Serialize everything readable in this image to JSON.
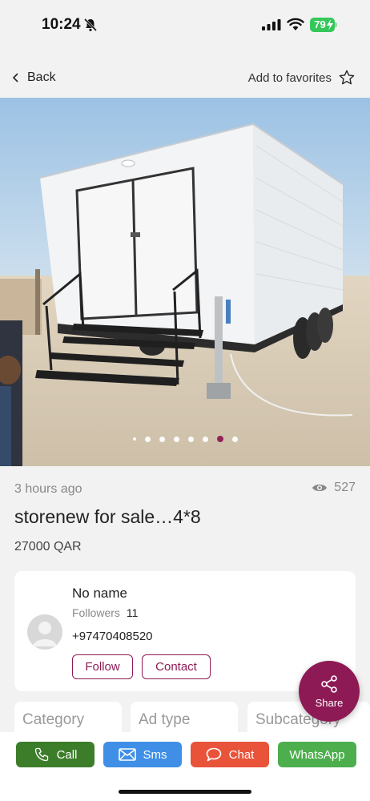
{
  "status_bar": {
    "time": "10:24",
    "battery": "79"
  },
  "nav": {
    "back_label": "Back",
    "favorites_label": "Add to favorites"
  },
  "gallery": {
    "image_count": 7,
    "active_index": 6
  },
  "listing": {
    "posted": "3 hours ago",
    "views": "527",
    "title": "storenew for sale…4*8",
    "price": "27000 QAR"
  },
  "seller": {
    "name": "No name",
    "followers_label": "Followers",
    "followers_count": "11",
    "phone": "+97470408520",
    "follow_label": "Follow",
    "contact_label": "Contact"
  },
  "attributes": [
    "Category",
    "Ad type",
    "Subcategory"
  ],
  "share_label": "Share",
  "actions": {
    "call": "Call",
    "sms": "Sms",
    "chat": "Chat",
    "whatsapp": "WhatsApp"
  },
  "colors": {
    "accent": "#8e1a55",
    "call": "#3c7d2a",
    "sms": "#3f8fe6",
    "chat": "#e8533a",
    "whatsapp": "#4cae4c"
  }
}
